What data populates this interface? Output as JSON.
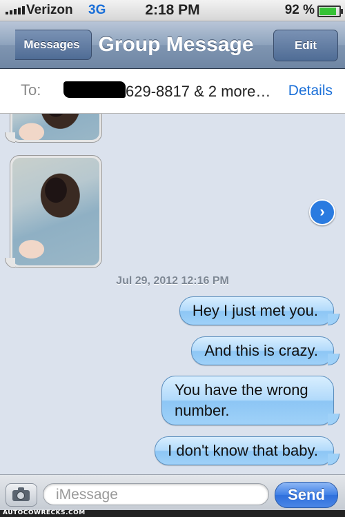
{
  "status_bar": {
    "carrier": "Verizon",
    "network": "3G",
    "time": "2:18 PM",
    "battery": "92 %",
    "battery_level": 0.92
  },
  "nav": {
    "back_label": "Messages",
    "title": "Group Message",
    "edit_label": "Edit"
  },
  "recipients": {
    "to_label": "To:",
    "text": "629-8817 & 2 more…",
    "details_label": "Details"
  },
  "thread": {
    "timestamp": "Jul 29, 2012 12:16 PM",
    "sent_messages": [
      "Hey I just met you.",
      "And this is crazy.",
      "You have the wrong number.",
      "I don't know that baby."
    ]
  },
  "composer": {
    "placeholder": "iMessage",
    "send_label": "Send"
  },
  "watermark": "AUTOCOWRECKS.COM",
  "colors": {
    "accent": "#1a6fd8",
    "sent_bubble": "#9fd1f8",
    "nav_bar": "#8ea3bd"
  },
  "icons": [
    "signal-icon",
    "battery-icon",
    "camera-icon",
    "forward-arrow-icon"
  ]
}
